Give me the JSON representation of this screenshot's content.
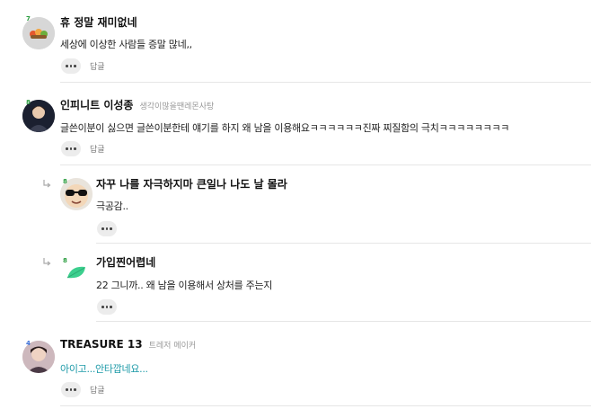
{
  "comments": [
    {
      "level": "7",
      "nickname": "휴 정말 재미없네",
      "rank": "",
      "text": "세상에 이상한 사람들 증말 많네,,",
      "reply_label": "답글",
      "avatar_icon": "fruit-sticker-icon"
    },
    {
      "level": "8",
      "nickname": "인피니트 이성종",
      "rank": "생각이많을땐레몬사탕",
      "text": "글쓴이분이 싫으면 글쓴이분한테 얘기를 하지 왜 남을 이용해요ㅋㅋㅋㅋㅋㅋ진짜 찌질함의 극치ㅋㅋㅋㅋㅋㅋㅋㅋ",
      "reply_label": "답글",
      "avatar_icon": "person-photo-icon"
    },
    {
      "level": "8",
      "nickname": "자꾸 나를 자극하지마 큰일나 나도 날 몰라",
      "rank": "",
      "text": "극공감..",
      "avatar_icon": "sunglasses-face-icon"
    },
    {
      "level": "8",
      "nickname": "가입찐어렵네",
      "rank": "",
      "text": "22 그니까.. 왜 남을 이용해서 상처를 주는지",
      "avatar_icon": "green-leaf-icon"
    },
    {
      "level": "4",
      "nickname": "TREASURE 13",
      "rank": "트레저 메이커",
      "text": "아이고...안타깝네요...",
      "reply_label": "답글",
      "avatar_icon": "person-photo-icon"
    }
  ],
  "colors": {
    "teal_text": "#1d9aa8",
    "level_7": "#2a9d3f",
    "level_8": "#2a9d3f",
    "level_4": "#3a6fd8",
    "leaf": "#3ccf8e"
  }
}
